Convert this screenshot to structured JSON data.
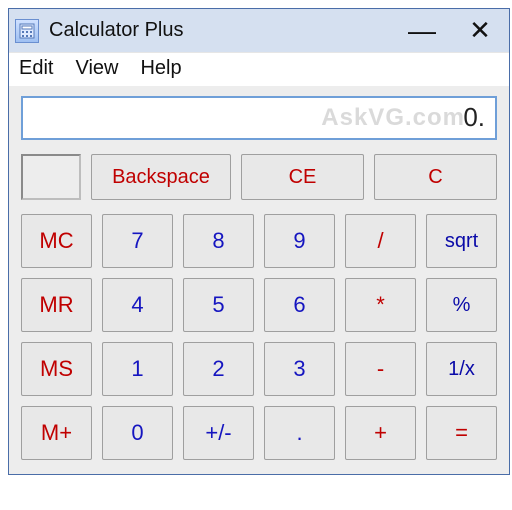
{
  "window": {
    "title": "Calculator Plus"
  },
  "menu": {
    "edit": "Edit",
    "view": "View",
    "help": "Help"
  },
  "display": {
    "value": "0.",
    "watermark": "AskVG.com"
  },
  "clear": {
    "backspace": "Backspace",
    "ce": "CE",
    "c": "C"
  },
  "memory": {
    "mc": "MC",
    "mr": "MR",
    "ms": "MS",
    "mplus": "M+"
  },
  "digits": {
    "d0": "0",
    "d1": "1",
    "d2": "2",
    "d3": "3",
    "d4": "4",
    "d5": "5",
    "d6": "6",
    "d7": "7",
    "d8": "8",
    "d9": "9"
  },
  "ops": {
    "div": "/",
    "mul": "*",
    "sub": "-",
    "add": "+",
    "sign": "+/-",
    "dot": ".",
    "sqrt": "sqrt",
    "pct": "%",
    "inv": "1/x",
    "eq": "="
  }
}
